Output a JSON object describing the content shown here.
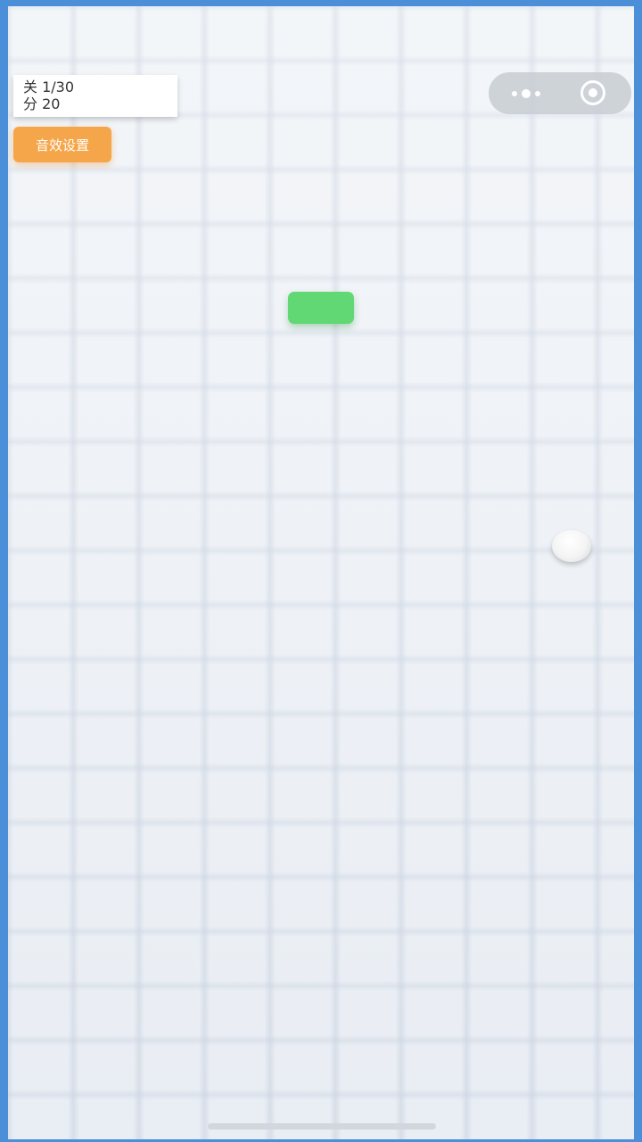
{
  "hud": {
    "level_label": "关",
    "level_value": "1/30",
    "score_label": "分",
    "score_value": "20"
  },
  "buttons": {
    "sound_settings": "音效设置"
  },
  "capsule": {
    "more_icon": "more-dots-icon",
    "close_icon": "target-circle-icon"
  },
  "colors": {
    "frame": "#4a8fd8",
    "paddle": "#62d874",
    "sound_button": "#f6a64a",
    "board": "#edf1f6"
  }
}
